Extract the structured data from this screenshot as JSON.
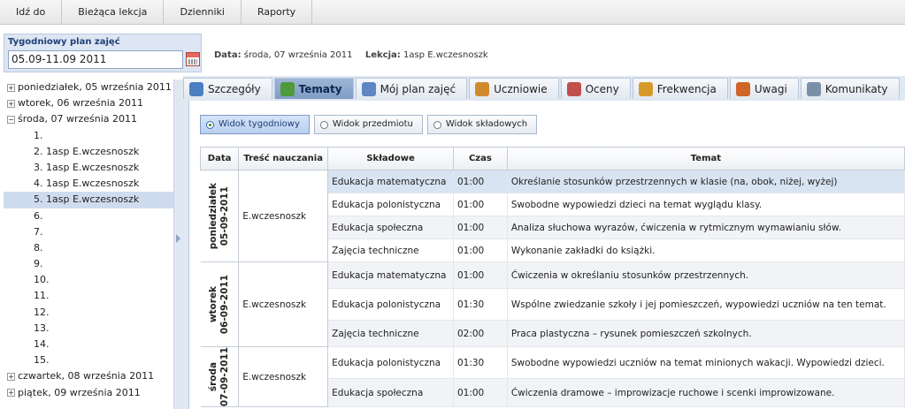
{
  "topnav": [
    "Idź do",
    "Bieżąca lekcja",
    "Dzienniki",
    "Raporty"
  ],
  "week": {
    "label": "Tygodniowy plan zajęć",
    "value": "05.09-11.09 2011"
  },
  "meta": {
    "data_label": "Data:",
    "data_value": "środa, 07 września 2011",
    "lesson_label": "Lekcja:",
    "lesson_value": "1asp E.wczesnoszk"
  },
  "tree": {
    "days_before": [
      "poniedziałek, 05 września 2011",
      "wtorek, 06 września 2011"
    ],
    "open_day": "środa, 07 września 2011",
    "lessons": [
      "1.",
      "2. 1asp E.wczesnoszk",
      "3. 1asp E.wczesnoszk",
      "4. 1asp E.wczesnoszk",
      "5. 1asp E.wczesnoszk",
      "6.",
      "7.",
      "8.",
      "9.",
      "10.",
      "11.",
      "12.",
      "13.",
      "14.",
      "15."
    ],
    "selected_lesson_index": 4,
    "days_after": [
      "czwartek, 08 września 2011",
      "piątek, 09 września 2011"
    ]
  },
  "tabs": [
    {
      "label": "Szczegóły",
      "icon": "magnifier-icon",
      "color": "#4a7fc1"
    },
    {
      "label": "Tematy",
      "icon": "question-icon",
      "color": "#4f9a3b",
      "active": true
    },
    {
      "label": "Mój plan zajęć",
      "icon": "grid-icon",
      "color": "#5d86c2"
    },
    {
      "label": "Uczniowie",
      "icon": "users-icon",
      "color": "#d08a2c"
    },
    {
      "label": "Oceny",
      "icon": "grades-icon",
      "color": "#c0504d"
    },
    {
      "label": "Frekwencja",
      "icon": "attendance-icon",
      "color": "#d69a2a"
    },
    {
      "label": "Uwagi",
      "icon": "notes-icon",
      "color": "#d0652a"
    },
    {
      "label": "Komunikaty",
      "icon": "messages-icon",
      "color": "#7b8fa8"
    }
  ],
  "views": [
    {
      "label": "Widok tygodniowy",
      "on": true
    },
    {
      "label": "Widok przedmiotu",
      "on": false
    },
    {
      "label": "Widok składowych",
      "on": false
    }
  ],
  "columns": [
    "Data",
    "Treść nauczania",
    "Składowe",
    "Czas",
    "Temat"
  ],
  "groups": [
    {
      "day": "poniedziałek",
      "date": "05-09-2011",
      "tresc": "E.wczesnoszk",
      "rows": [
        {
          "s": "Edukacja matematyczna",
          "c": "01:00",
          "t": "Określanie stosunków przestrzennych w klasie (na, obok, niżej, wyżej)"
        },
        {
          "s": "Edukacja polonistyczna",
          "c": "01:00",
          "t": "Swobodne wypowiedzi dzieci na temat wyglądu klasy."
        },
        {
          "s": "Edukacja społeczna",
          "c": "01:00",
          "t": "Analiza słuchowa wyrazów, ćwiczenia w rytmicznym wymawianiu słów."
        },
        {
          "s": "Zajęcia techniczne",
          "c": "01:00",
          "t": "Wykonanie zakładki do książki."
        }
      ]
    },
    {
      "day": "wtorek",
      "date": "06-09-2011",
      "tresc": "E.wczesnoszk",
      "rows": [
        {
          "s": "Edukacja matematyczna",
          "c": "01:00",
          "t": "Ćwiczenia w określaniu stosunków przestrzennych."
        },
        {
          "s": "Edukacja polonistyczna",
          "c": "01:30",
          "t": "Wspólne zwiedzanie szkoły i jej pomieszczeń, wypowiedzi uczniów na ten temat."
        },
        {
          "s": "Zajęcia techniczne",
          "c": "02:00",
          "t": "Praca plastyczna – rysunek pomieszczeń szkolnych."
        }
      ]
    },
    {
      "day": "środa",
      "date": "07-09-2011",
      "tresc": "E.wczesnoszk",
      "rows": [
        {
          "s": "Edukacja polonistyczna",
          "c": "01:30",
          "t": "Swobodne wypowiedzi uczniów na temat minionych wakacji. Wypowiedzi dzieci."
        },
        {
          "s": "Edukacja społeczna",
          "c": "01:00",
          "t": "Ćwiczenia dramowe – improwizacje ruchowe i scenki improwizowane."
        }
      ]
    }
  ]
}
